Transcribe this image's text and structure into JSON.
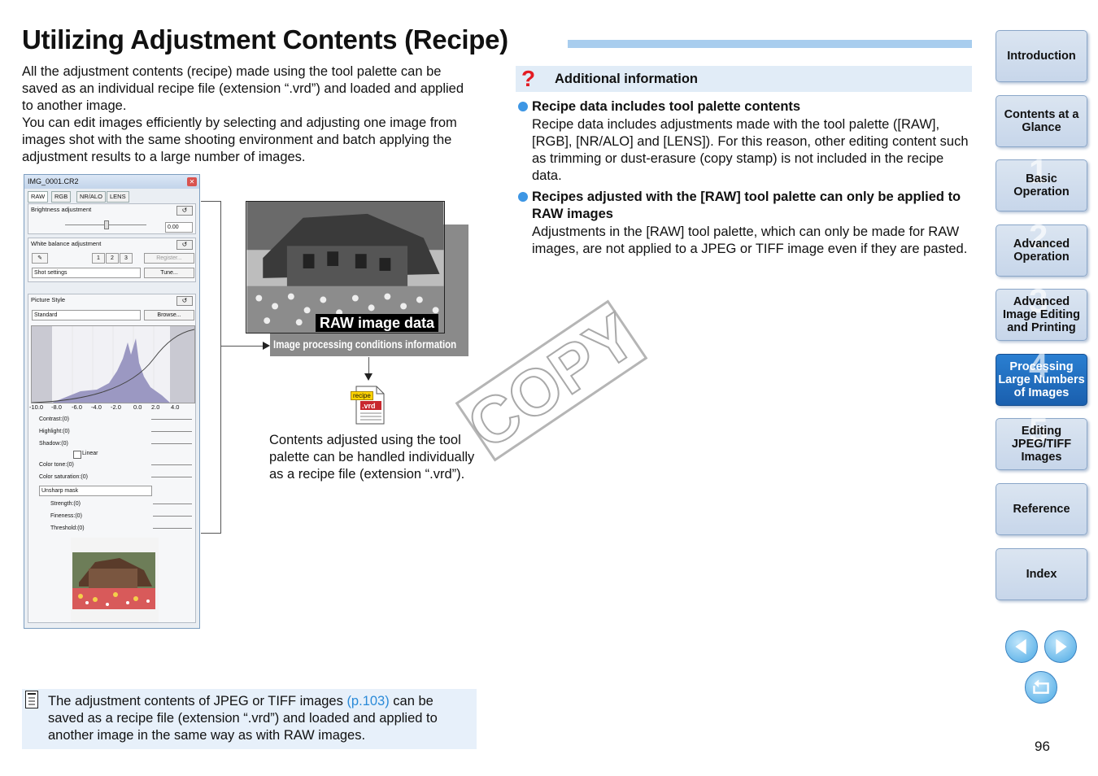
{
  "title": "Utilizing Adjustment Contents (Recipe)",
  "intro": {
    "p1": "All the adjustment contents (recipe) made using the tool palette can be saved as an individual recipe file (extension “.vrd”) and loaded and applied to another image.",
    "p2": "You can edit images efficiently by selecting and adjusting one image from images shot with the same shooting environment and batch applying the adjustment results to a large number of images."
  },
  "tool_palette": {
    "window_title": "IMG_0001.CR2",
    "tabs": [
      "RAW",
      "RGB",
      "NR/ALO",
      "LENS"
    ],
    "brightness_label": "Brightness adjustment",
    "brightness_value": "0.00",
    "wb_label": "White balance adjustment",
    "wb_numbers": [
      "1",
      "2",
      "3"
    ],
    "register_label": "Register...",
    "shot_settings": "Shot settings",
    "tune_label": "Tune...",
    "picture_style_label": "Picture Style",
    "picture_style_value": "Standard",
    "browse_label": "Browse...",
    "axis": [
      "-10.0",
      "-8.0",
      "-6.0",
      "-4.0",
      "-2.0",
      "0.0",
      "2.0",
      "4.0"
    ],
    "params": [
      "Contrast:(0)",
      "Highlight:(0)",
      "Shadow:(0)",
      "Color tone:(0)",
      "Color saturation:(0)"
    ],
    "linear_label": "Linear",
    "unsharp_label": "Unsharp mask",
    "sharp_params": [
      "Strength:(0)",
      "Fineness:(0)",
      "Threshold:(0)"
    ]
  },
  "diagram": {
    "raw_label": "RAW image data",
    "proc_label": "Image processing conditions information",
    "file_tag": "recipe",
    "file_ext": ".vrd",
    "caption": "Contents adjusted using the tool palette can be handled individually as a recipe file (extension “.vrd”)."
  },
  "watermark": "COPY",
  "additional_info": {
    "title": "Additional information",
    "items": [
      {
        "title": "Recipe data includes tool palette contents",
        "body": "Recipe data includes adjustments made with the tool palette ([RAW], [RGB], [NR/ALO] and [LENS]). For this reason, other editing content such as trimming or dust-erasure (copy stamp) is not included in the recipe data."
      },
      {
        "title": "Recipes adjusted with the [RAW] tool palette can only be applied to RAW images",
        "body": "Adjustments in the [RAW] tool palette, which can only be made for RAW images, are not applied to a JPEG or TIFF image even if they are pasted."
      }
    ]
  },
  "note": {
    "text_before": "The adjustment contents of JPEG or TIFF images ",
    "link": "(p.103)",
    "text_after": " can be saved as a recipe file (extension “.vrd”) and loaded and applied to another image in the same way as with RAW images."
  },
  "nav": {
    "items": [
      {
        "label": "Introduction",
        "num": ""
      },
      {
        "label": "Contents at a Glance",
        "num": ""
      },
      {
        "label": "Basic Operation",
        "num": "1"
      },
      {
        "label": "Advanced Operation",
        "num": "2"
      },
      {
        "label": "Advanced Image Editing and Printing",
        "num": "3"
      },
      {
        "label": "Processing Large Numbers of Images",
        "num": "4"
      },
      {
        "label": "Editing JPEG/TIFF Images",
        "num": "5"
      },
      {
        "label": "Reference",
        "num": ""
      },
      {
        "label": "Index",
        "num": ""
      }
    ],
    "active_index": 5
  },
  "page_number": "96",
  "colors": {
    "accent": "#a8cdee",
    "nav_active": "#1f6fc4",
    "link": "#2a8ad8",
    "question_mark": "#e31b23"
  }
}
